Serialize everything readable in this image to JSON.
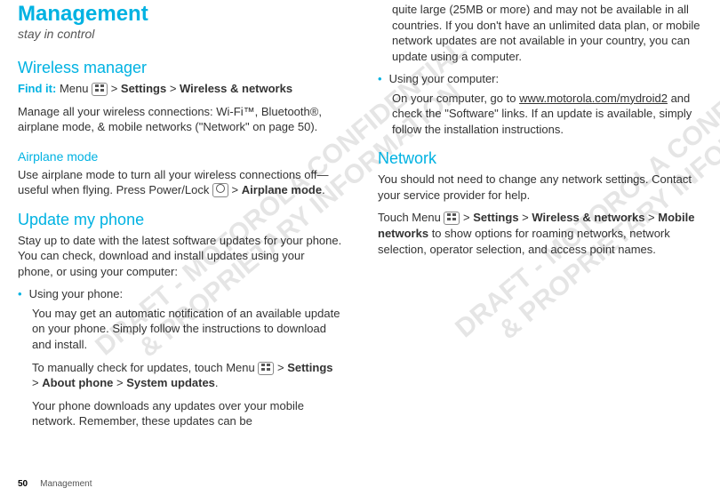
{
  "left": {
    "title": "Management",
    "subtitle": "stay in control",
    "wireless_heading": "Wireless manager",
    "findit_label": "Find it:",
    "findit_menu_word": " Menu ",
    "findit_tail_1": " > ",
    "findit_settings": "Settings",
    "findit_tail_2": " > ",
    "findit_wireless": "Wireless & networks",
    "wireless_para": "Manage all your wireless connections: Wi-Fi™, Bluetooth®, airplane mode, & mobile networks (\"Network\" on page 50).",
    "airplane_heading": "Airplane mode",
    "airplane_para_a": "Use airplane mode to turn all your wireless connections off—useful when flying. Press Power/Lock ",
    "airplane_para_b": " > ",
    "airplane_mode_bold": "Airplane mode",
    "airplane_para_c": ".",
    "update_heading": "Update my phone",
    "update_para": "Stay up to date with the latest software updates for your phone. You can check, download and install updates using your phone, or using your computer:",
    "bullet1": "Using your phone:",
    "b1p1": "You may get an automatic notification of an available update on your phone. Simply follow the instructions to download and install.",
    "b1p2_a": "To manually check for updates, touch Menu ",
    "b1p2_b": " > ",
    "b1p2_settings": "Settings",
    "b1p2_c": " > ",
    "b1p2_about": "About phone",
    "b1p2_d": " > ",
    "b1p2_sys": "System updates",
    "b1p2_e": ".",
    "b1p3": "Your phone downloads any updates over your mobile network. Remember, these updates can be",
    "footer_page": "50",
    "footer_label": "Management"
  },
  "right": {
    "cont_para": "quite large (25MB or more) and may not be available in all countries. If you don't have an unlimited data plan, or mobile network updates are not available in your country, you can update using a computer.",
    "bullet2": "Using your computer:",
    "b2p1_a": "On your computer, go to ",
    "b2p1_link": "www.motorola.com/mydroid2",
    "b2p1_b": " and check the \"Software\" links. If an update is available, simply follow the installation instructions.",
    "network_heading": "Network",
    "net_para1": "You should not need to change any network settings. Contact your service provider for help.",
    "net_para2_a": "Touch Menu ",
    "net_para2_b": " > ",
    "net_settings": "Settings",
    "net_para2_c": " > ",
    "net_wireless": "Wireless & networks",
    "net_para2_d": " > ",
    "net_mobile": "Mobile networks",
    "net_para2_e": " to show options for roaming networks, network selection, operator selection, and access point names."
  },
  "watermark_line1": "DRAFT - MOTOROLA CONFIDENTIAL",
  "watermark_line2": "& PROPRIETARY INFORMATION"
}
